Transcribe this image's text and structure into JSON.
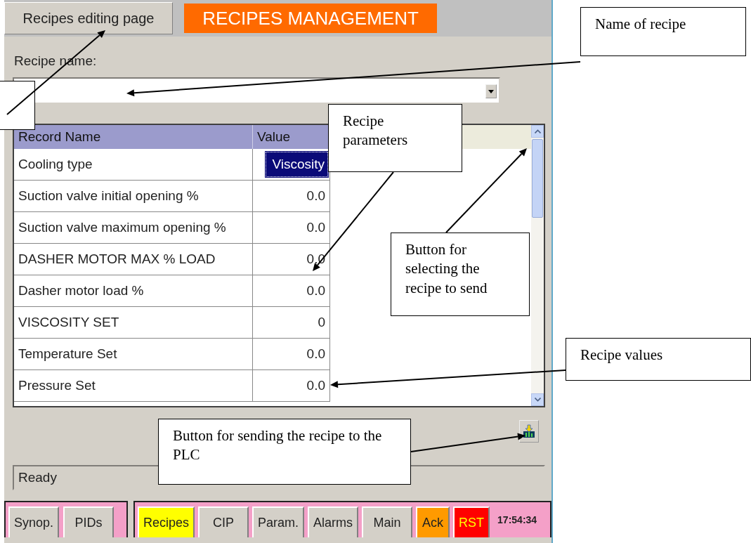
{
  "header": {
    "edit_button": "Recipes editing page",
    "title": "RECIPES MANAGEMENT"
  },
  "recipe_name": {
    "label": "Recipe name:"
  },
  "table": {
    "columns": [
      "Record Name",
      "Value"
    ],
    "rows": [
      {
        "name": "Cooling type",
        "value": "Viscosity",
        "selected": true
      },
      {
        "name": "Suction valve initial opening %",
        "value": "0.0",
        "selected": false
      },
      {
        "name": "Suction valve maximum opening %",
        "value": "0.0",
        "selected": false
      },
      {
        "name": "DASHER MOTOR MAX % LOAD",
        "value": "0.0",
        "selected": false
      },
      {
        "name": "Dasher motor load %",
        "value": "0.0",
        "selected": false
      },
      {
        "name": "VISCOSITY SET",
        "value": "0",
        "selected": false
      },
      {
        "name": "Temperature Set",
        "value": "0.0",
        "selected": false
      },
      {
        "name": "Pressure Set",
        "value": "0.0",
        "selected": false
      }
    ]
  },
  "status_bar": "Ready",
  "nav_left": [
    {
      "label": "Synop.",
      "kind": "nav",
      "selected": false
    },
    {
      "label": "PIDs",
      "kind": "nav",
      "selected": false
    }
  ],
  "nav_right": [
    {
      "label": "Recipes",
      "kind": "nav",
      "selected": true
    },
    {
      "label": "CIP",
      "kind": "nav",
      "selected": false
    },
    {
      "label": "Param.",
      "kind": "nav",
      "selected": false
    },
    {
      "label": "Alarms",
      "kind": "nav",
      "selected": false
    },
    {
      "label": "Main",
      "kind": "nav",
      "selected": false
    },
    {
      "label": "Ack",
      "kind": "ack"
    },
    {
      "label": "RST",
      "kind": "reset"
    }
  ],
  "clock": "17:54:34",
  "annotations": [
    {
      "kind": "blank"
    },
    {
      "kind": "text",
      "text": "Name of recipe"
    },
    {
      "kind": "text",
      "text": "Recipe parameters"
    },
    {
      "kind": "text",
      "text": "Button for selecting the recipe to send"
    },
    {
      "kind": "text",
      "text": "Recipe values"
    },
    {
      "kind": "text",
      "text": "Button for sending the recipe to the PLC"
    }
  ]
}
